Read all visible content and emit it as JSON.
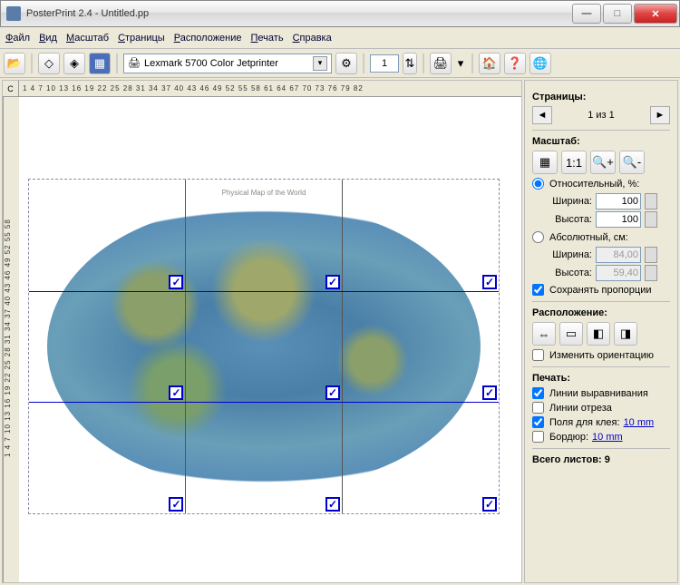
{
  "title": "PosterPrint 2.4 - Untitled.pp",
  "menu": [
    "Файл",
    "Вид",
    "Масштаб",
    "Страницы",
    "Расположение",
    "Печать",
    "Справка"
  ],
  "toolbar": {
    "printer": "Lexmark 5700 Color Jetprinter",
    "page_spinner": "1"
  },
  "ruler": {
    "corner": "С",
    "h": "1  4  7  10  13  16  19  22  25  28  31  34  37  40  43  46  49  52  55  58  61  64  67  70  73  76  79  82",
    "v": "1  4  7  10  13  16  19  22  25  28  31  34  37  40  43  46  49  52  55  58"
  },
  "canvas": {
    "caption": "Physical Map of the World"
  },
  "side": {
    "pages_title": "Страницы:",
    "pages_of": "1 из 1",
    "scale_title": "Масштаб:",
    "relative_label": "Относительный, %:",
    "absolute_label": "Абсолютный, см:",
    "width_label": "Ширина:",
    "height_label": "Высота:",
    "rel_width": "100",
    "rel_height": "100",
    "abs_width": "84,00",
    "abs_height": "59,40",
    "keep_ratio": "Сохранять пропорции",
    "layout_title": "Расположение:",
    "change_orient": "Изменить ориентацию",
    "print_title": "Печать:",
    "align_lines": "Линии выравнивания",
    "cut_lines": "Линии отреза",
    "glue_fields": "Поля для клея:",
    "glue_link": "10 mm",
    "border_label": "Бордюр:",
    "border_link": "10 mm",
    "total_label": "Всего листов:",
    "total_value": "9"
  }
}
